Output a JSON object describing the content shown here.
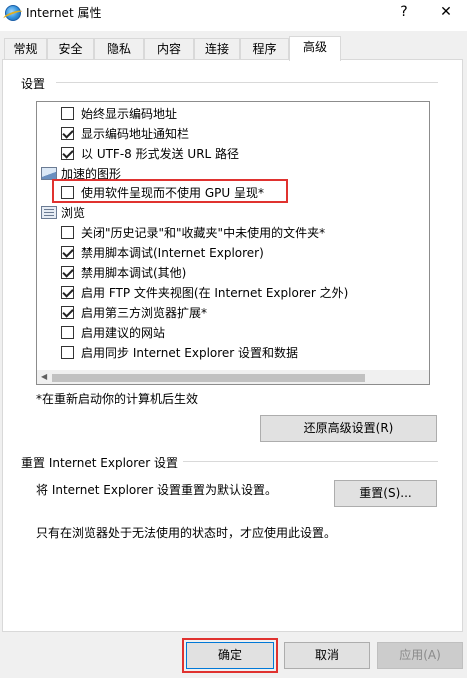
{
  "window": {
    "title": "Internet 属性",
    "help_label": "?",
    "close_label": "✕"
  },
  "tabs": [
    {
      "label": "常规"
    },
    {
      "label": "安全"
    },
    {
      "label": "隐私"
    },
    {
      "label": "内容"
    },
    {
      "label": "连接"
    },
    {
      "label": "程序"
    },
    {
      "label": "高级",
      "active": true
    }
  ],
  "settings_group": {
    "title": "设置",
    "items": [
      {
        "type": "checkbox",
        "label": "始终显示编码地址",
        "checked": false
      },
      {
        "type": "checkbox",
        "label": "显示编码地址通知栏",
        "checked": true
      },
      {
        "type": "checkbox",
        "label": "以 UTF-8 形式发送 URL 路径",
        "checked": true
      },
      {
        "type": "category",
        "label": "加速的图形",
        "icon": "image-icon"
      },
      {
        "type": "checkbox",
        "label": "使用软件呈现而不使用 GPU 呈现*",
        "checked": false,
        "highlighted": true
      },
      {
        "type": "category",
        "label": "浏览",
        "icon": "list-icon"
      },
      {
        "type": "checkbox",
        "label": "关闭\"历史记录\"和\"收藏夹\"中未使用的文件夹*",
        "checked": false
      },
      {
        "type": "checkbox",
        "label": "禁用脚本调试(Internet Explorer)",
        "checked": true
      },
      {
        "type": "checkbox",
        "label": "禁用脚本调试(其他)",
        "checked": true
      },
      {
        "type": "checkbox",
        "label": "启用 FTP 文件夹视图(在 Internet Explorer 之外)",
        "checked": true
      },
      {
        "type": "checkbox",
        "label": "启用第三方浏览器扩展*",
        "checked": true
      },
      {
        "type": "checkbox",
        "label": "启用建议的网站",
        "checked": false
      },
      {
        "type": "checkbox",
        "label": "启用同步 Internet Explorer 设置和数据",
        "checked": false
      }
    ],
    "restart_note": "*在重新启动你的计算机后生效",
    "restore_button": "还原高级设置(R)"
  },
  "reset_group": {
    "title": "重置 Internet Explorer 设置",
    "description": "将 Internet Explorer 设置重置为默认设置。",
    "reset_button": "重置(S)...",
    "warning": "只有在浏览器处于无法使用的状态时，才应使用此设置。"
  },
  "footer": {
    "ok": "确定",
    "cancel": "取消",
    "apply": "应用(A)"
  },
  "colors": {
    "highlight": "#e0322f",
    "accent": "#0078d7"
  }
}
